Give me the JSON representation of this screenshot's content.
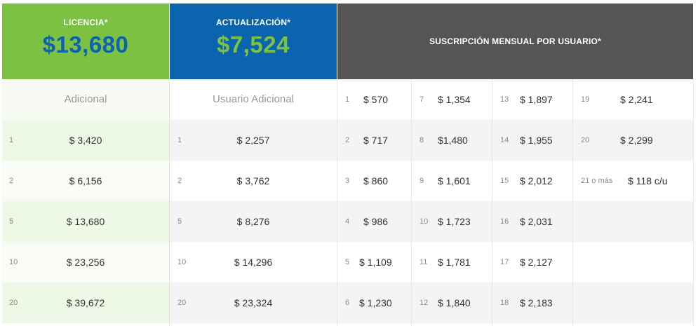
{
  "header": {
    "licencia": {
      "label": "LICENCIA*",
      "price": "$13,680"
    },
    "actualizacion": {
      "label": "ACTUALIZACIÓN*",
      "price": "$7,524"
    },
    "suscripcion": {
      "label": "SUSCRIPCIÓN MENSUAL POR USUARIO*"
    }
  },
  "licencia_table": {
    "subheader": "Adicional",
    "rows": [
      {
        "qty": "1",
        "price": "$ 3,420"
      },
      {
        "qty": "2",
        "price": "$ 6,156"
      },
      {
        "qty": "5",
        "price": "$ 13,680"
      },
      {
        "qty": "10",
        "price": "$ 23,256"
      },
      {
        "qty": "20",
        "price": "$ 39,672"
      }
    ]
  },
  "actualizacion_table": {
    "subheader": "Usuario Adicional",
    "rows": [
      {
        "qty": "1",
        "price": "$ 2,257"
      },
      {
        "qty": "2",
        "price": "$ 3,762"
      },
      {
        "qty": "5",
        "price": "$ 8,276"
      },
      {
        "qty": "10",
        "price": "$ 14,296"
      },
      {
        "qty": "20",
        "price": "$ 23,324"
      }
    ]
  },
  "suscripcion_table": {
    "columns": [
      [
        {
          "qty": "1",
          "price": "$ 570"
        },
        {
          "qty": "2",
          "price": "$ 717"
        },
        {
          "qty": "3",
          "price": "$ 860"
        },
        {
          "qty": "4",
          "price": "$ 986"
        },
        {
          "qty": "5",
          "price": "$ 1,109"
        },
        {
          "qty": "6",
          "price": "$ 1,230"
        }
      ],
      [
        {
          "qty": "7",
          "price": "$ 1,354"
        },
        {
          "qty": "8",
          "price": "$1,480"
        },
        {
          "qty": "9",
          "price": "$ 1,601"
        },
        {
          "qty": "10",
          "price": "$ 1,723"
        },
        {
          "qty": "11",
          "price": "$ 1,781"
        },
        {
          "qty": "12",
          "price": "$ 1,840"
        }
      ],
      [
        {
          "qty": "13",
          "price": "$ 1,897"
        },
        {
          "qty": "14",
          "price": "$ 1,955"
        },
        {
          "qty": "15",
          "price": "$ 2,012"
        },
        {
          "qty": "16",
          "price": "$ 2,031"
        },
        {
          "qty": "17",
          "price": "$ 2,127"
        },
        {
          "qty": "18",
          "price": "$ 2,183"
        }
      ],
      [
        {
          "qty": "19",
          "price": "$ 2,241"
        },
        {
          "qty": "20",
          "price": "$ 2,299"
        },
        {
          "qty": "21 o más",
          "price": "$ 118 c/u"
        },
        {
          "qty": "",
          "price": ""
        },
        {
          "qty": "",
          "price": ""
        },
        {
          "qty": "",
          "price": ""
        }
      ]
    ]
  },
  "colors": {
    "green": "#7cc142",
    "blue": "#0a64ae",
    "gray_header": "#555555",
    "green_row": "#eef8e6",
    "gray_row": "#f4f4f4"
  }
}
